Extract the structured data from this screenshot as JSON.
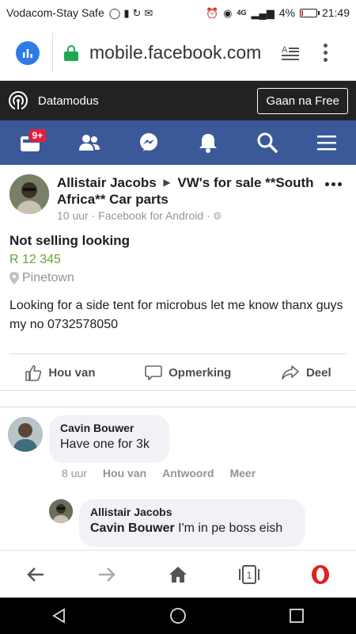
{
  "status_bar": {
    "carrier": "Vodacom-Stay Safe",
    "network": "4G",
    "battery": "4%",
    "battery_level": 0.04,
    "time": "21:49"
  },
  "browser": {
    "url": "mobile.facebook.com",
    "data_mode_label": "Datamodus",
    "free_button": "Gaan na Free",
    "tab_count": "1"
  },
  "fb_nav": {
    "badge": "9+"
  },
  "post": {
    "author": "Allistair Jacobs",
    "group": "VW's for sale **South Africa** Car parts",
    "meta": "10 uur · Facebook for Android ·",
    "title": "Not selling looking",
    "price": "R 12 345",
    "location": "Pinetown",
    "body": "Looking for a side tent for microbus let me know thanx guys my no 0732578050",
    "actions": {
      "like": "Hou van",
      "comment": "Opmerking",
      "share": "Deel"
    }
  },
  "comments": [
    {
      "name": "Cavin Bouwer",
      "text": "Have one for 3k",
      "time": "8 uur",
      "like": "Hou van",
      "reply": "Antwoord",
      "more": "Meer"
    },
    {
      "name": "Allistair Jacobs",
      "mention": "Cavin Bouwer",
      "text": " I'm in pe boss eish"
    }
  ],
  "colors": {
    "fb_blue": "#3b5998",
    "price_green": "#5fa82f",
    "badge_red": "#e41e3f",
    "secure_green": "#1fa84f"
  }
}
